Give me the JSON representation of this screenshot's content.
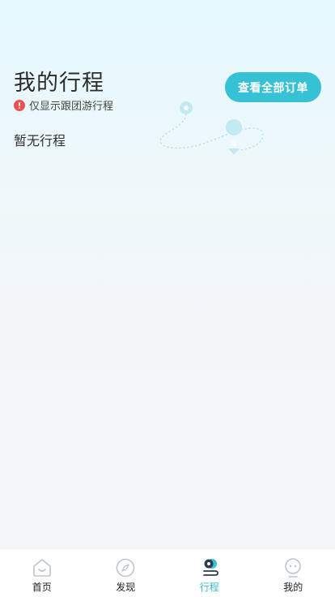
{
  "header": {
    "title": "我的行程",
    "notice": "仅显示跟团游行程",
    "orders_button": "查看全部订单"
  },
  "main": {
    "empty_text": "暂无行程"
  },
  "tabbar": {
    "items": [
      {
        "label": "首页",
        "icon": "home-icon",
        "active": false
      },
      {
        "label": "发现",
        "icon": "compass-icon",
        "active": false
      },
      {
        "label": "行程",
        "icon": "route-icon",
        "active": true
      },
      {
        "label": "我的",
        "icon": "profile-icon",
        "active": false
      }
    ]
  },
  "colors": {
    "accent": "#36c1d4",
    "alert": "#f05050",
    "active_tab": "#36b9cc"
  }
}
